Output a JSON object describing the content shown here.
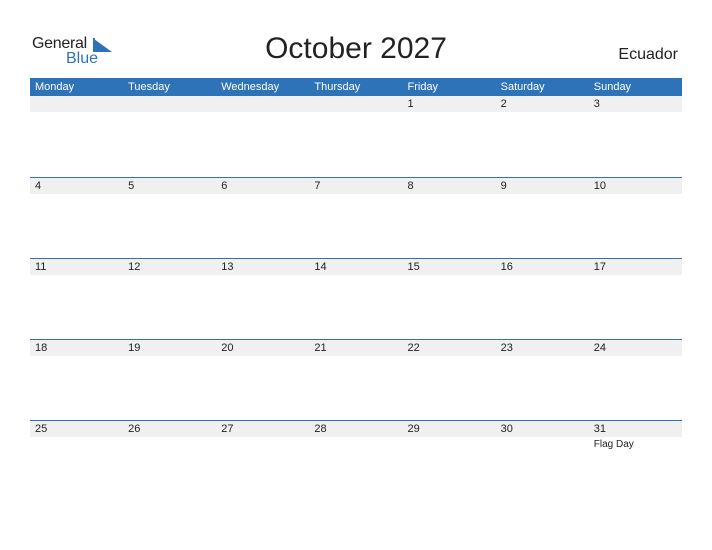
{
  "logo": {
    "word1": "General",
    "word2": "Blue"
  },
  "title": "October 2027",
  "country": "Ecuador",
  "colors": {
    "accent": "#2e73b8",
    "strip": "#f0f0f0"
  },
  "weekdays": [
    "Monday",
    "Tuesday",
    "Wednesday",
    "Thursday",
    "Friday",
    "Saturday",
    "Sunday"
  ],
  "weeks": [
    {
      "days": [
        "",
        "",
        "",
        "",
        "1",
        "2",
        "3"
      ],
      "events": [
        "",
        "",
        "",
        "",
        "",
        "",
        ""
      ]
    },
    {
      "days": [
        "4",
        "5",
        "6",
        "7",
        "8",
        "9",
        "10"
      ],
      "events": [
        "",
        "",
        "",
        "",
        "",
        "",
        ""
      ]
    },
    {
      "days": [
        "11",
        "12",
        "13",
        "14",
        "15",
        "16",
        "17"
      ],
      "events": [
        "",
        "",
        "",
        "",
        "",
        "",
        ""
      ]
    },
    {
      "days": [
        "18",
        "19",
        "20",
        "21",
        "22",
        "23",
        "24"
      ],
      "events": [
        "",
        "",
        "",
        "",
        "",
        "",
        ""
      ]
    },
    {
      "days": [
        "25",
        "26",
        "27",
        "28",
        "29",
        "30",
        "31"
      ],
      "events": [
        "",
        "",
        "",
        "",
        "",
        "",
        "Flag Day"
      ]
    }
  ]
}
